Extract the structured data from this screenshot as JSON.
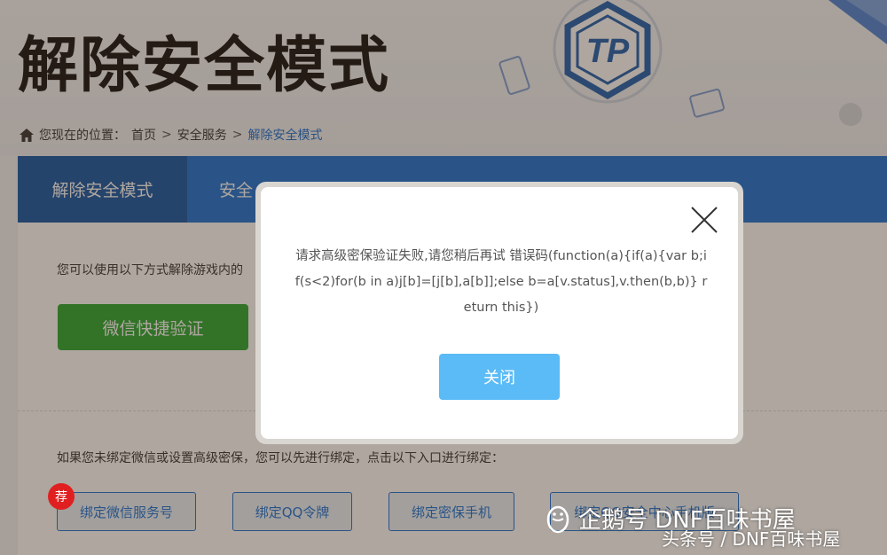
{
  "page": {
    "title": "解除安全模式",
    "breadcrumb": {
      "prefix": "您现在的位置：",
      "items": [
        "首页",
        "安全服务",
        "解除安全模式"
      ],
      "separator": ">"
    },
    "logo_text": "TP"
  },
  "tabs": [
    {
      "label": "解除安全模式",
      "active": true
    },
    {
      "label": "安全",
      "active": false
    }
  ],
  "content": {
    "intro": "您可以使用以下方式解除游戏内的",
    "wechat_button": "微信快捷验证",
    "bind_text": "如果您未绑定微信或设置高级密保，您可以先进行绑定，点击以下入口进行绑定：",
    "bind_buttons": [
      "绑定微信服务号",
      "绑定QQ令牌",
      "绑定密保手机",
      "绑定QQ安全中心手机版"
    ],
    "badge": "荐"
  },
  "modal": {
    "message": "请求高级密保验证失败,请您稍后再试 错误码(function(a){if(a){var b;if(s<2)for(b in a)j[b]=[j[b],a[b]];else b=a[v.status],v.then(b,b)} return this})",
    "close_button": "关闭"
  },
  "watermark": {
    "line1": "企鹅号 DNF百味书屋",
    "line2": "头条号 / DNF百味书屋"
  },
  "colors": {
    "primary_blue": "#1d73d6",
    "active_tab": "#1456a8",
    "wechat_green": "#2aa733",
    "modal_button": "#5bbbf6",
    "breadcrumb_current": "#1a6fd0"
  },
  "icons": [
    "home-icon",
    "close-icon",
    "tp-logo",
    "penguin-icon"
  ]
}
